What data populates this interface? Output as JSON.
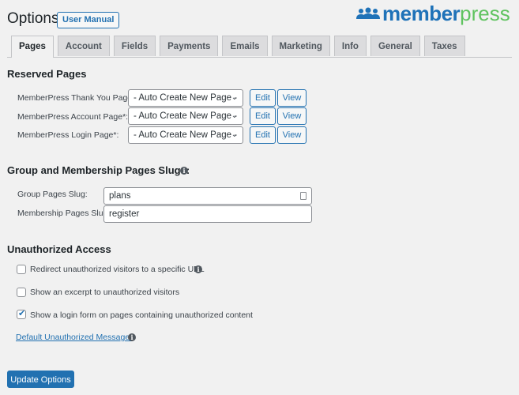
{
  "header": {
    "title": "Options",
    "user_manual_label": "User Manual",
    "logo": {
      "word_bold": "member",
      "word_light": "press",
      "icon": "users-group-icon"
    }
  },
  "tabs": [
    {
      "label": "Pages",
      "active": true
    },
    {
      "label": "Account"
    },
    {
      "label": "Fields"
    },
    {
      "label": "Payments"
    },
    {
      "label": "Emails"
    },
    {
      "label": "Marketing"
    },
    {
      "label": "Info"
    },
    {
      "label": "General"
    },
    {
      "label": "Taxes"
    }
  ],
  "reserved_pages": {
    "heading": "Reserved Pages",
    "rows": [
      {
        "label": "MemberPress Thank You Page*:",
        "value": "- Auto Create New Page -",
        "edit": "Edit",
        "view": "View"
      },
      {
        "label": "MemberPress Account Page*:",
        "value": "- Auto Create New Page -",
        "edit": "Edit",
        "view": "View"
      },
      {
        "label": "MemberPress Login Page*:",
        "value": "- Auto Create New Page -",
        "edit": "Edit",
        "view": "View"
      }
    ]
  },
  "slugs": {
    "heading": "Group and Membership Pages Slugs:",
    "group_label": "Group Pages Slug:",
    "group_value": "plans",
    "membership_label": "Membership Pages Slug:",
    "membership_value": "register"
  },
  "unauthorized": {
    "heading": "Unauthorized Access",
    "options": [
      {
        "label": "Redirect unauthorized visitors to a specific URL",
        "checked": false,
        "info": true
      },
      {
        "label": "Show an excerpt to unauthorized visitors",
        "checked": false
      },
      {
        "label": "Show a login form on pages containing unauthorized content",
        "checked": true
      }
    ],
    "default_message_link": "Default Unauthorized Message:"
  },
  "update_label": "Update Options",
  "info_glyph": "i",
  "check_glyph": "✔",
  "chevron_glyph": "⌄"
}
